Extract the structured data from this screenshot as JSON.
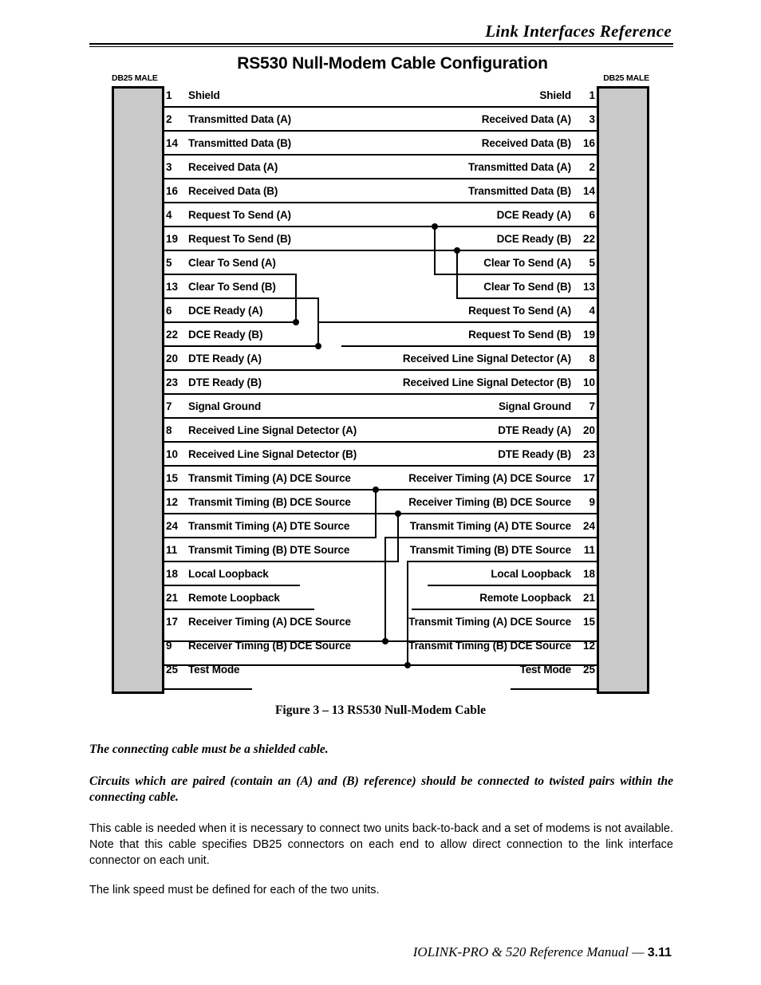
{
  "header": {
    "title": "Link Interfaces Reference"
  },
  "figure": {
    "title": "RS530 Null-Modem Cable Configuration",
    "caption": "Figure 3 – 13  RS530 Null-Modem Cable",
    "left_connector_label": "DB25 MALE",
    "right_connector_label": "DB25 MALE"
  },
  "pins": [
    {
      "left_pin": "1",
      "left_name": "Shield",
      "right_name": "Shield",
      "right_pin": "1"
    },
    {
      "left_pin": "2",
      "left_name": "Transmitted Data (A)",
      "right_name": "Received Data (A)",
      "right_pin": "3"
    },
    {
      "left_pin": "14",
      "left_name": "Transmitted Data (B)",
      "right_name": "Received Data (B)",
      "right_pin": "16"
    },
    {
      "left_pin": "3",
      "left_name": "Received Data (A)",
      "right_name": "Transmitted Data (A)",
      "right_pin": "2"
    },
    {
      "left_pin": "16",
      "left_name": "Received Data (B)",
      "right_name": "Transmitted Data (B)",
      "right_pin": "14"
    },
    {
      "left_pin": "4",
      "left_name": "Request To Send (A)",
      "right_name": "DCE Ready (A)",
      "right_pin": "6"
    },
    {
      "left_pin": "19",
      "left_name": "Request To Send (B)",
      "right_name": "DCE Ready (B)",
      "right_pin": "22"
    },
    {
      "left_pin": "5",
      "left_name": "Clear To Send (A)",
      "right_name": "Clear To Send (A)",
      "right_pin": "5"
    },
    {
      "left_pin": "13",
      "left_name": "Clear To Send (B)",
      "right_name": "Clear To Send (B)",
      "right_pin": "13"
    },
    {
      "left_pin": "6",
      "left_name": "DCE Ready (A)",
      "right_name": "Request To Send (A)",
      "right_pin": "4"
    },
    {
      "left_pin": "22",
      "left_name": "DCE Ready (B)",
      "right_name": "Request To Send (B)",
      "right_pin": "19"
    },
    {
      "left_pin": "20",
      "left_name": "DTE Ready (A)",
      "right_name": "Received Line Signal Detector (A)",
      "right_pin": "8"
    },
    {
      "left_pin": "23",
      "left_name": "DTE Ready (B)",
      "right_name": "Received Line Signal Detector (B)",
      "right_pin": "10"
    },
    {
      "left_pin": "7",
      "left_name": "Signal Ground",
      "right_name": "Signal Ground",
      "right_pin": "7"
    },
    {
      "left_pin": "8",
      "left_name": "Received Line Signal Detector (A)",
      "right_name": "DTE Ready (A)",
      "right_pin": "20"
    },
    {
      "left_pin": "10",
      "left_name": "Received Line Signal Detector (B)",
      "right_name": "DTE Ready (B)",
      "right_pin": "23"
    },
    {
      "left_pin": "15",
      "left_name": "Transmit Timing (A) DCE Source",
      "right_name": "Receiver Timing (A) DCE Source",
      "right_pin": "17"
    },
    {
      "left_pin": "12",
      "left_name": "Transmit Timing (B) DCE Source",
      "right_name": "Receiver Timing (B) DCE Source",
      "right_pin": "9"
    },
    {
      "left_pin": "24",
      "left_name": "Transmit Timing (A) DTE Source",
      "right_name": "Transmit Timing (A) DTE Source",
      "right_pin": "24"
    },
    {
      "left_pin": "11",
      "left_name": "Transmit Timing (B) DTE Source",
      "right_name": "Transmit Timing (B) DTE Source",
      "right_pin": "11"
    },
    {
      "left_pin": "18",
      "left_name": "Local Loopback",
      "right_name": "Local Loopback",
      "right_pin": "18"
    },
    {
      "left_pin": "21",
      "left_name": "Remote Loopback",
      "right_name": "Remote Loopback",
      "right_pin": "21"
    },
    {
      "left_pin": "17",
      "left_name": "Receiver Timing (A) DCE Source",
      "right_name": "Transmit Timing (A) DCE Source",
      "right_pin": "15"
    },
    {
      "left_pin": "9",
      "left_name": "Receiver Timing (B) DCE Source",
      "right_name": "Transmit Timing (B) DCE Source",
      "right_pin": "12"
    },
    {
      "left_pin": "25",
      "left_name": "Test Mode",
      "right_name": "Test Mode",
      "right_pin": "25"
    }
  ],
  "body": {
    "italic_1": "The connecting cable must be a shielded cable.",
    "italic_2": "Circuits which are paired (contain an (A) and (B) reference) should be connected to twisted pairs within the connecting cable.",
    "para_1": "This cable is needed when it is necessary to connect two units back-to-back and a set of modems is not available.  Note that this cable specifies DB25 connectors on each end to allow direct connection to the link interface connector on each unit.",
    "para_2": "The link speed must be defined for each of the two units."
  },
  "footer": {
    "manual": "IOLINK-PRO & 520 Reference Manual —",
    "page": "3.11"
  },
  "colors": {
    "connector_fill": "#c9c9c9",
    "ink": "#000000",
    "page": "#ffffff"
  }
}
